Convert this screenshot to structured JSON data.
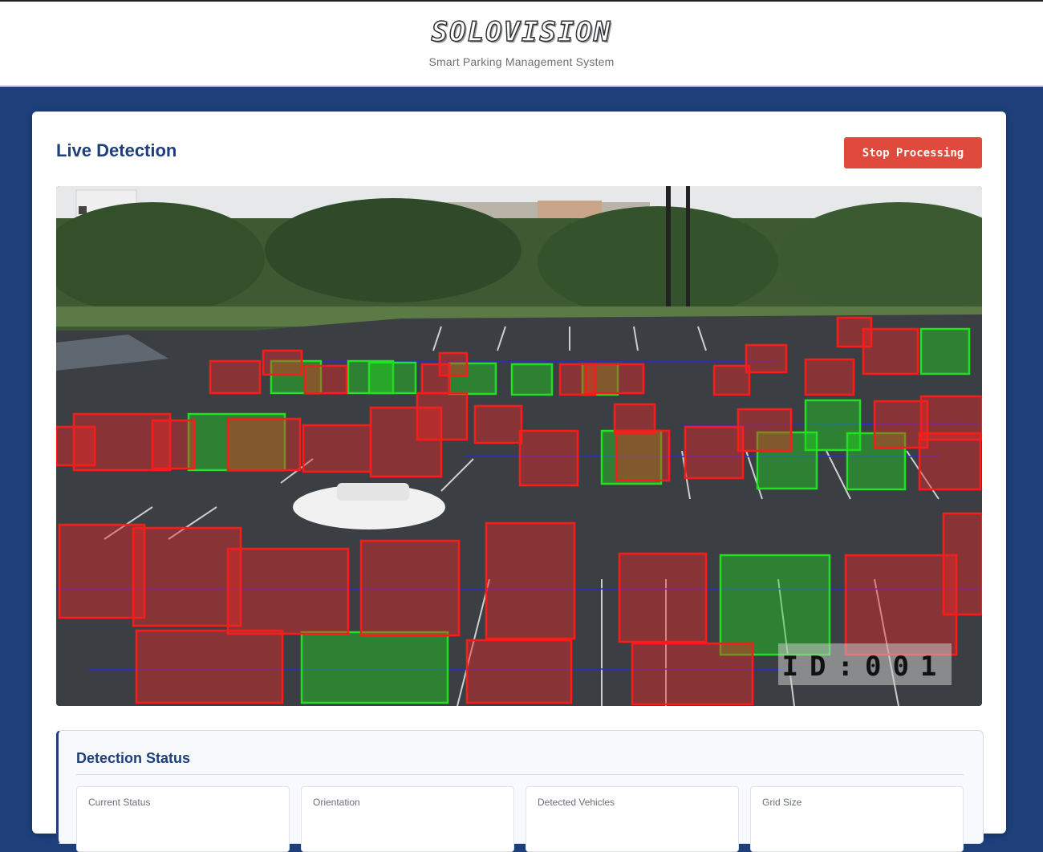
{
  "header": {
    "logo_text": "SOLOVISION",
    "tagline": "Smart Parking Management System"
  },
  "main": {
    "title": "Live Detection",
    "stop_button_label": "Stop Processing",
    "video_overlay_id": "ID:001",
    "legend_colors": {
      "occupied": "#ff1a1a",
      "vacant": "#22e022",
      "lane_line": "#2a2ad0"
    }
  },
  "status": {
    "title": "Detection Status",
    "boxes": [
      {
        "label": "Current Status"
      },
      {
        "label": "Orientation"
      },
      {
        "label": "Detected Vehicles"
      },
      {
        "label": "Grid Size"
      }
    ]
  }
}
